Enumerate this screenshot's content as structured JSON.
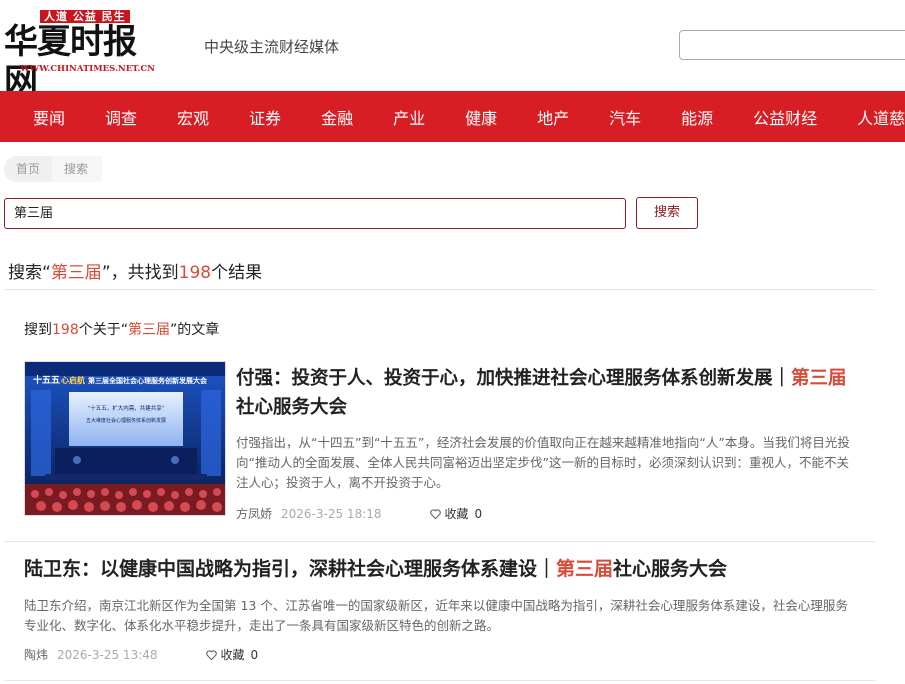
{
  "header": {
    "logo_top": "人道 公益 民生",
    "logo_main": "华夏时报网",
    "logo_url": "WWW.CHINATIMES.NET.CN",
    "slogan": "中央级主流财经媒体"
  },
  "nav": {
    "items": [
      "要闻",
      "调查",
      "宏观",
      "证券",
      "金融",
      "产业",
      "健康",
      "地产",
      "汽车",
      "能源",
      "公益财经",
      "人道慈"
    ]
  },
  "breadcrumb": {
    "home": "首页",
    "current": "搜索"
  },
  "search": {
    "query": "第三届",
    "button_label": "搜索"
  },
  "summary": {
    "prefix": "搜索“",
    "keyword": "第三届",
    "middle": "”，共找到",
    "count": "198",
    "suffix": "个结果"
  },
  "subsummary": {
    "prefix": "搜到",
    "count": "198",
    "middle": "个关于“",
    "keyword": "第三届",
    "suffix": "”的文章"
  },
  "articles": [
    {
      "title_main": "付强：投资于人、投资于心，加快推进社会心理服务体系创新发展｜",
      "title_highlight": "第三届",
      "title_tail": "社心服务大会",
      "description": "付强指出，从“十四五”到“十五五”，经济社会发展的价值取向正在越来越精准地指向“人”本身。当我们将目光投向“推动人的全面发展、全体人民共同富裕迈出坚定步伐”这一新的目标时，必须深刻认识到：重视人，不能不关注人心；投资于人，离不开投资于心。",
      "author": "方凤娇",
      "date": "2026-3-25 18:18",
      "favorite_label": "收藏",
      "favorite_count": "0",
      "thumb_texts": {
        "banner": "第三届全国社会心理服务创新发展大会",
        "screen_line1": "“十五五，扩大内需，共建共享”",
        "screen_line2": "五大维度社会心理服务体系创新发展",
        "brand_left": "十五五",
        "brand_right": "心启航"
      }
    },
    {
      "title_main": "陆卫东：以健康中国战略为指引，深耕社会心理服务体系建设｜",
      "title_highlight": "第三届",
      "title_tail": "社心服务大会",
      "description": "陆卫东介绍，南京江北新区作为全国第 13 个、江苏省唯一的国家级新区，近年来以健康中国战略为指引，深耕社会心理服务体系建设，社会心理服务专业化、数字化、体系化水平稳步提升，走出了一条具有国家级新区特色的创新之路。",
      "author": "陶炜",
      "date": "2026-3-25 13:48",
      "favorite_label": "收藏",
      "favorite_count": "0"
    }
  ],
  "colors": {
    "brand_red": "#d81e25",
    "highlight": "#d84b3a",
    "button_border": "#8b1c21"
  }
}
